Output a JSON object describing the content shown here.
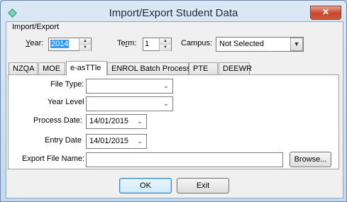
{
  "window": {
    "title": "Import/Export Student Data",
    "close_glyph": "✕"
  },
  "import_export": {
    "group_label": "Import/Export",
    "year_label_prefix": "",
    "year_label_underline": "Y",
    "year_label_rest": "ear:",
    "year_value": "2014",
    "term_label_prefix": "Te",
    "term_label_underline": "r",
    "term_label_rest": "m:",
    "term_value": "1",
    "campus_label": "Campus:",
    "campus_value": "Not Selected"
  },
  "tabs": [
    {
      "label": "NZQA"
    },
    {
      "label": "MOE"
    },
    {
      "label": "e-asTTle"
    },
    {
      "label": "ENROL Batch Process"
    },
    {
      "label": "PTE"
    },
    {
      "label": "DEEWR"
    }
  ],
  "form": {
    "file_type_label": "File Type:",
    "file_type_value": "",
    "year_level_label": "Year Level",
    "year_level_value": "",
    "process_date_label": "Process Date:",
    "process_date_value": "14/01/2015",
    "entry_date_label": "Entry Date",
    "entry_date_value": "14/01/2015",
    "export_file_label": "Export File Name:",
    "export_file_value": "",
    "browse_label": "Browse..."
  },
  "footer": {
    "ok_label": "OK",
    "exit_label": "Exit"
  }
}
